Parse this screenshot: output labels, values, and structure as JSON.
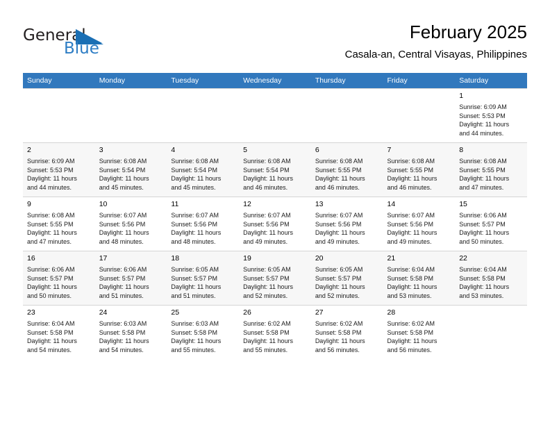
{
  "brand": {
    "name_part1": "General",
    "name_part2": "Blue",
    "triangle_color": "#1a6fb4",
    "text_color": "#231f20",
    "blue_text_color": "#2d7dc4"
  },
  "header": {
    "month_title": "February 2025",
    "location": "Casala-an, Central Visayas, Philippines"
  },
  "theme": {
    "header_bg": "#3178bd",
    "header_text": "#ffffff",
    "row_shade": "#f7f7f7",
    "grid_line": "#d5d5d5"
  },
  "weekdays": [
    "Sunday",
    "Monday",
    "Tuesday",
    "Wednesday",
    "Thursday",
    "Friday",
    "Saturday"
  ],
  "labels": {
    "sunrise_prefix": "Sunrise:",
    "sunset_prefix": "Sunset:",
    "daylight_prefix": "Daylight:"
  },
  "weeks": [
    {
      "shaded": false,
      "days": [
        {
          "empty": true
        },
        {
          "empty": true
        },
        {
          "empty": true
        },
        {
          "empty": true
        },
        {
          "empty": true
        },
        {
          "empty": true
        },
        {
          "empty": false,
          "date": "1",
          "sunrise": "Sunrise: 6:09 AM",
          "sunset": "Sunset: 5:53 PM",
          "daylight_line1": "Daylight: 11 hours",
          "daylight_line2": "and 44 minutes."
        }
      ]
    },
    {
      "shaded": true,
      "days": [
        {
          "empty": false,
          "date": "2",
          "sunrise": "Sunrise: 6:09 AM",
          "sunset": "Sunset: 5:53 PM",
          "daylight_line1": "Daylight: 11 hours",
          "daylight_line2": "and 44 minutes."
        },
        {
          "empty": false,
          "date": "3",
          "sunrise": "Sunrise: 6:08 AM",
          "sunset": "Sunset: 5:54 PM",
          "daylight_line1": "Daylight: 11 hours",
          "daylight_line2": "and 45 minutes."
        },
        {
          "empty": false,
          "date": "4",
          "sunrise": "Sunrise: 6:08 AM",
          "sunset": "Sunset: 5:54 PM",
          "daylight_line1": "Daylight: 11 hours",
          "daylight_line2": "and 45 minutes."
        },
        {
          "empty": false,
          "date": "5",
          "sunrise": "Sunrise: 6:08 AM",
          "sunset": "Sunset: 5:54 PM",
          "daylight_line1": "Daylight: 11 hours",
          "daylight_line2": "and 46 minutes."
        },
        {
          "empty": false,
          "date": "6",
          "sunrise": "Sunrise: 6:08 AM",
          "sunset": "Sunset: 5:55 PM",
          "daylight_line1": "Daylight: 11 hours",
          "daylight_line2": "and 46 minutes."
        },
        {
          "empty": false,
          "date": "7",
          "sunrise": "Sunrise: 6:08 AM",
          "sunset": "Sunset: 5:55 PM",
          "daylight_line1": "Daylight: 11 hours",
          "daylight_line2": "and 46 minutes."
        },
        {
          "empty": false,
          "date": "8",
          "sunrise": "Sunrise: 6:08 AM",
          "sunset": "Sunset: 5:55 PM",
          "daylight_line1": "Daylight: 11 hours",
          "daylight_line2": "and 47 minutes."
        }
      ]
    },
    {
      "shaded": false,
      "days": [
        {
          "empty": false,
          "date": "9",
          "sunrise": "Sunrise: 6:08 AM",
          "sunset": "Sunset: 5:55 PM",
          "daylight_line1": "Daylight: 11 hours",
          "daylight_line2": "and 47 minutes."
        },
        {
          "empty": false,
          "date": "10",
          "sunrise": "Sunrise: 6:07 AM",
          "sunset": "Sunset: 5:56 PM",
          "daylight_line1": "Daylight: 11 hours",
          "daylight_line2": "and 48 minutes."
        },
        {
          "empty": false,
          "date": "11",
          "sunrise": "Sunrise: 6:07 AM",
          "sunset": "Sunset: 5:56 PM",
          "daylight_line1": "Daylight: 11 hours",
          "daylight_line2": "and 48 minutes."
        },
        {
          "empty": false,
          "date": "12",
          "sunrise": "Sunrise: 6:07 AM",
          "sunset": "Sunset: 5:56 PM",
          "daylight_line1": "Daylight: 11 hours",
          "daylight_line2": "and 49 minutes."
        },
        {
          "empty": false,
          "date": "13",
          "sunrise": "Sunrise: 6:07 AM",
          "sunset": "Sunset: 5:56 PM",
          "daylight_line1": "Daylight: 11 hours",
          "daylight_line2": "and 49 minutes."
        },
        {
          "empty": false,
          "date": "14",
          "sunrise": "Sunrise: 6:07 AM",
          "sunset": "Sunset: 5:56 PM",
          "daylight_line1": "Daylight: 11 hours",
          "daylight_line2": "and 49 minutes."
        },
        {
          "empty": false,
          "date": "15",
          "sunrise": "Sunrise: 6:06 AM",
          "sunset": "Sunset: 5:57 PM",
          "daylight_line1": "Daylight: 11 hours",
          "daylight_line2": "and 50 minutes."
        }
      ]
    },
    {
      "shaded": true,
      "days": [
        {
          "empty": false,
          "date": "16",
          "sunrise": "Sunrise: 6:06 AM",
          "sunset": "Sunset: 5:57 PM",
          "daylight_line1": "Daylight: 11 hours",
          "daylight_line2": "and 50 minutes."
        },
        {
          "empty": false,
          "date": "17",
          "sunrise": "Sunrise: 6:06 AM",
          "sunset": "Sunset: 5:57 PM",
          "daylight_line1": "Daylight: 11 hours",
          "daylight_line2": "and 51 minutes."
        },
        {
          "empty": false,
          "date": "18",
          "sunrise": "Sunrise: 6:05 AM",
          "sunset": "Sunset: 5:57 PM",
          "daylight_line1": "Daylight: 11 hours",
          "daylight_line2": "and 51 minutes."
        },
        {
          "empty": false,
          "date": "19",
          "sunrise": "Sunrise: 6:05 AM",
          "sunset": "Sunset: 5:57 PM",
          "daylight_line1": "Daylight: 11 hours",
          "daylight_line2": "and 52 minutes."
        },
        {
          "empty": false,
          "date": "20",
          "sunrise": "Sunrise: 6:05 AM",
          "sunset": "Sunset: 5:57 PM",
          "daylight_line1": "Daylight: 11 hours",
          "daylight_line2": "and 52 minutes."
        },
        {
          "empty": false,
          "date": "21",
          "sunrise": "Sunrise: 6:04 AM",
          "sunset": "Sunset: 5:58 PM",
          "daylight_line1": "Daylight: 11 hours",
          "daylight_line2": "and 53 minutes."
        },
        {
          "empty": false,
          "date": "22",
          "sunrise": "Sunrise: 6:04 AM",
          "sunset": "Sunset: 5:58 PM",
          "daylight_line1": "Daylight: 11 hours",
          "daylight_line2": "and 53 minutes."
        }
      ]
    },
    {
      "shaded": false,
      "days": [
        {
          "empty": false,
          "date": "23",
          "sunrise": "Sunrise: 6:04 AM",
          "sunset": "Sunset: 5:58 PM",
          "daylight_line1": "Daylight: 11 hours",
          "daylight_line2": "and 54 minutes."
        },
        {
          "empty": false,
          "date": "24",
          "sunrise": "Sunrise: 6:03 AM",
          "sunset": "Sunset: 5:58 PM",
          "daylight_line1": "Daylight: 11 hours",
          "daylight_line2": "and 54 minutes."
        },
        {
          "empty": false,
          "date": "25",
          "sunrise": "Sunrise: 6:03 AM",
          "sunset": "Sunset: 5:58 PM",
          "daylight_line1": "Daylight: 11 hours",
          "daylight_line2": "and 55 minutes."
        },
        {
          "empty": false,
          "date": "26",
          "sunrise": "Sunrise: 6:02 AM",
          "sunset": "Sunset: 5:58 PM",
          "daylight_line1": "Daylight: 11 hours",
          "daylight_line2": "and 55 minutes."
        },
        {
          "empty": false,
          "date": "27",
          "sunrise": "Sunrise: 6:02 AM",
          "sunset": "Sunset: 5:58 PM",
          "daylight_line1": "Daylight: 11 hours",
          "daylight_line2": "and 56 minutes."
        },
        {
          "empty": false,
          "date": "28",
          "sunrise": "Sunrise: 6:02 AM",
          "sunset": "Sunset: 5:58 PM",
          "daylight_line1": "Daylight: 11 hours",
          "daylight_line2": "and 56 minutes."
        },
        {
          "empty": true
        }
      ]
    }
  ]
}
